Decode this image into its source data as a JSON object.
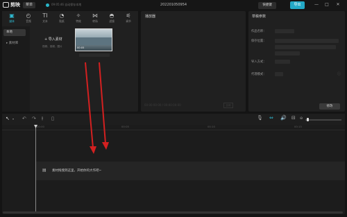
{
  "app": {
    "name": "剪映",
    "menu_label": "菜单",
    "save_status": "09:05:46 自动保存本地",
    "project_title": "202201050954"
  },
  "topbar": {
    "shortcut_label": "快捷键",
    "export_label": "导出",
    "min": "—",
    "max": "□",
    "close": "✕"
  },
  "toolbar": {
    "tools": [
      {
        "label": "媒体",
        "icon": "▣"
      },
      {
        "label": "音频",
        "icon": "◴"
      },
      {
        "label": "文本",
        "icon": "TI"
      },
      {
        "label": "贴纸",
        "icon": "◔"
      },
      {
        "label": "特效",
        "icon": "✧"
      },
      {
        "label": "转场",
        "icon": "⋈"
      },
      {
        "label": "滤镜",
        "icon": "◓"
      },
      {
        "label": "调节",
        "icon": "⚟"
      }
    ]
  },
  "media": {
    "nav": {
      "local": "本地",
      "library": "▸ 素材库"
    },
    "import_label": "+ 导入素材",
    "import_sub": "视频、音频、图片",
    "thumb_stamp": "00:05"
  },
  "player": {
    "title": "播放器",
    "time": "00:00:00:00 / 00:00:00:00",
    "ratio": "比例"
  },
  "props": {
    "title": "草稿参数",
    "labels": [
      "作品名称：",
      "保存位置：",
      "导入方式：",
      "代理模式："
    ]
  },
  "edit_label": "修改",
  "timeline": {
    "ticks": [
      "00:00",
      "00:05",
      "00:10",
      "00:15"
    ],
    "hint": "素材拖拽到这里，开始你的大作吧~",
    "track_icon": "▤"
  },
  "annotation": {
    "color": "#d42020"
  }
}
